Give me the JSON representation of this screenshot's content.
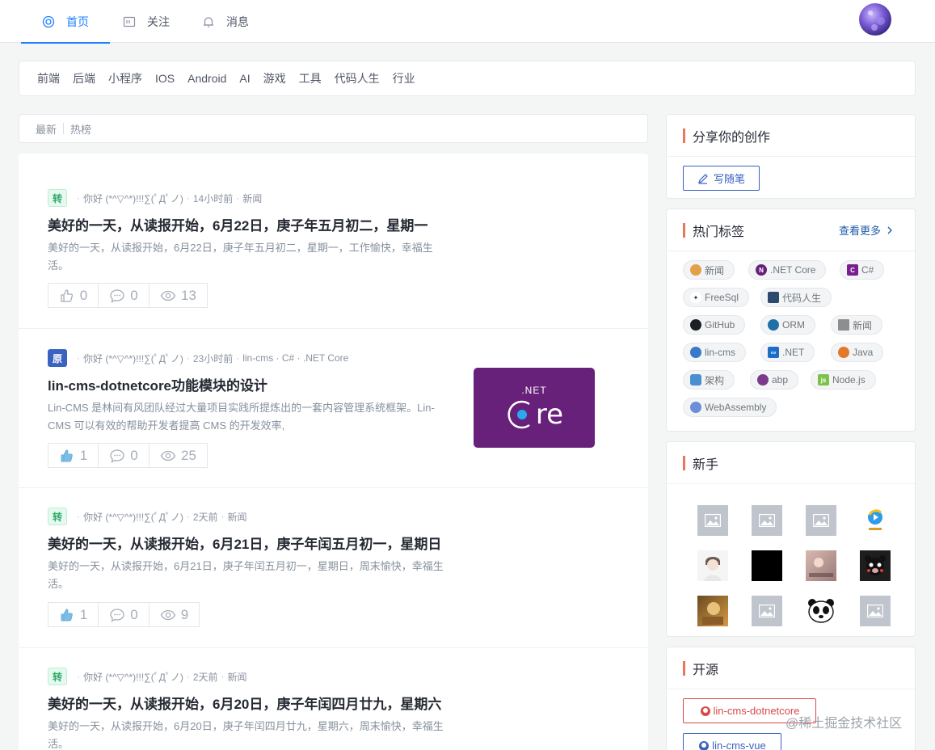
{
  "nav": {
    "tabs": [
      {
        "label": "首页",
        "icon": "home-icon",
        "active": true
      },
      {
        "label": "关注",
        "icon": "follow-icon"
      },
      {
        "label": "消息",
        "icon": "bell-icon"
      }
    ]
  },
  "categories": [
    "前端",
    "后端",
    "小程序",
    "IOS",
    "Android",
    "AI",
    "游戏",
    "工具",
    "代码人生",
    "行业"
  ],
  "sort": {
    "latest": "最新",
    "hot": "热榜"
  },
  "articles": [
    {
      "badge": "转",
      "author": "你好 (*^▽^*)!!!∑(ﾟДﾟノ)",
      "time": "14小时前",
      "tags": "新闻",
      "title": "美好的一天，从读报开始，6月22日，庚子年五月初二，星期一",
      "summary": "美好的一天，从读报开始，6月22日，庚子年五月初二，星期一，工作愉快，幸福生活。",
      "likes": "0",
      "comments": "0",
      "views": "13"
    },
    {
      "badge": "原",
      "author": "你好 (*^▽^*)!!!∑(ﾟДﾟノ)",
      "time": "23小时前",
      "tags": "lin-cms · C# · .NET Core",
      "title": "lin-cms-dotnetcore功能模块的设计",
      "summary": "Lin-CMS 是林间有风团队经过大量项目实践所提炼出的一套内容管理系统框架。Lin-CMS 可以有效的帮助开发者提高 CMS 的开发效率,",
      "likes": "1",
      "comments": "0",
      "views": "25",
      "thumb_top": ".NET",
      "thumb_bottom": "re"
    },
    {
      "badge": "转",
      "author": "你好 (*^▽^*)!!!∑(ﾟДﾟノ)",
      "time": "2天前",
      "tags": "新闻",
      "title": "美好的一天，从读报开始，6月21日，庚子年闰五月初一，星期日",
      "summary": "美好的一天，从读报开始，6月21日，庚子年闰五月初一，星期日，周末愉快，幸福生活。",
      "likes": "1",
      "comments": "0",
      "views": "9"
    },
    {
      "badge": "转",
      "author": "你好 (*^▽^*)!!!∑(ﾟДﾟノ)",
      "time": "2天前",
      "tags": "新闻",
      "title": "美好的一天，从读报开始，6月20日，庚子年闰四月廿九，星期六",
      "summary": "美好的一天，从读报开始，6月20日，庚子年闰四月廿九，星期六，周末愉快，幸福生活。"
    }
  ],
  "sidebar": {
    "share": {
      "title": "分享你的创作",
      "button": "写随笔"
    },
    "tags": {
      "title": "热门标签",
      "more": "查看更多",
      "items": [
        "新闻",
        ".NET Core",
        "C#",
        "FreeSql",
        "代码人生",
        "GitHub",
        "ORM",
        "新闻",
        "lin-cms",
        ".NET",
        "Java",
        "架构",
        "abp",
        "Node.js",
        "WebAssembly"
      ]
    },
    "newbie": {
      "title": "新手"
    },
    "opensource": {
      "title": "开源",
      "links": [
        "lin-cms-dotnetcore",
        "lin-cms-vue"
      ]
    }
  },
  "watermark": "@稀土掘金技术社区",
  "colors": {
    "accent": "#1e80ff",
    "card_marker": "#e8765a",
    "net_core_purple": "#68217a"
  }
}
